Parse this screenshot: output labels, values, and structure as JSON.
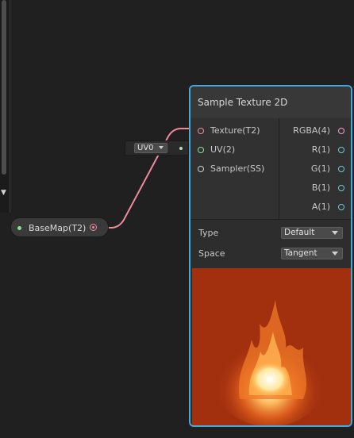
{
  "node": {
    "title": "Sample Texture 2D",
    "inputs": [
      "Texture(T2)",
      "UV(2)",
      "Sampler(SS)"
    ],
    "outputs": [
      "RGBA(4)",
      "R(1)",
      "G(1)",
      "B(1)",
      "A(1)"
    ],
    "type_label": "Type",
    "type_value": "Default",
    "space_label": "Space",
    "space_value": "Tangent"
  },
  "property_node": {
    "label": "BaseMap(T2)"
  },
  "uv_dropdown": {
    "value": "UV0"
  },
  "colors": {
    "selection_outline": "#44a8d8",
    "texture_wire": "#f08a98",
    "uv_wire": "#8ee08e",
    "vector_port": "#6fc8d8"
  }
}
